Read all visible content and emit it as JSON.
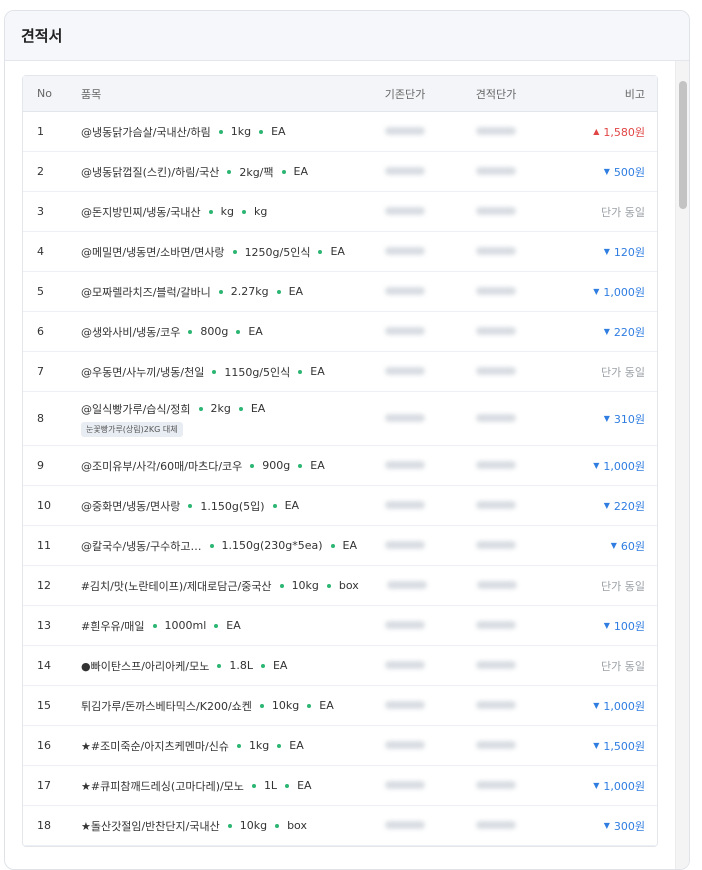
{
  "title": "견적서",
  "columns": {
    "no": "No",
    "item": "품목",
    "base_price": "기존단가",
    "quote_price": "견적단가",
    "note": "비고"
  },
  "rows": [
    {
      "no": "1",
      "parts": [
        "@냉동닭가슴살/국내산/하림",
        "1kg",
        "EA"
      ],
      "tag": "",
      "change": "up",
      "note": "1,580원"
    },
    {
      "no": "2",
      "parts": [
        "@냉동닭껍질(스킨)/하림/국산",
        "2kg/팩",
        "EA"
      ],
      "tag": "",
      "change": "down",
      "note": "500원"
    },
    {
      "no": "3",
      "parts": [
        "@돈지방민찌/냉동/국내산",
        "kg",
        "kg"
      ],
      "tag": "",
      "change": "same",
      "note": "단가 동일"
    },
    {
      "no": "4",
      "parts": [
        "@메밀면/냉동면/소바면/면사랑",
        "1250g/5인식",
        "EA"
      ],
      "tag": "",
      "change": "down",
      "note": "120원"
    },
    {
      "no": "5",
      "parts": [
        "@모짜렐라치즈/블럭/갈바니",
        "2.27kg",
        "EA"
      ],
      "tag": "",
      "change": "down",
      "note": "1,000원"
    },
    {
      "no": "6",
      "parts": [
        "@생와사비/냉동/코우",
        "800g",
        "EA"
      ],
      "tag": "",
      "change": "down",
      "note": "220원"
    },
    {
      "no": "7",
      "parts": [
        "@우동면/사누끼/냉동/천일",
        "1150g/5인식",
        "EA"
      ],
      "tag": "",
      "change": "same",
      "note": "단가 동일"
    },
    {
      "no": "8",
      "parts": [
        "@일식빵가루/습식/정희",
        "2kg",
        "EA"
      ],
      "tag": "눈꽃빵가루(상림)2KG 대체",
      "change": "down",
      "note": "310원"
    },
    {
      "no": "9",
      "parts": [
        "@조미유부/사각/60매/마츠다/코우",
        "900g",
        "EA"
      ],
      "tag": "",
      "change": "down",
      "note": "1,000원"
    },
    {
      "no": "10",
      "parts": [
        "@중화면/냉동/면사랑",
        "1.150g(5입)",
        "EA"
      ],
      "tag": "",
      "change": "down",
      "note": "220원"
    },
    {
      "no": "11",
      "parts": [
        "@칼국수/냉동/구수하고…",
        "1.150g(230g*5ea)",
        "EA"
      ],
      "tag": "",
      "change": "down",
      "note": "60원"
    },
    {
      "no": "12",
      "parts": [
        "#김치/맛(노란테이프)/제대로담근/중국산",
        "10kg",
        "box"
      ],
      "tag": "",
      "change": "same",
      "note": "단가 동일"
    },
    {
      "no": "13",
      "parts": [
        "#흰우유/매일",
        "1000ml",
        "EA"
      ],
      "tag": "",
      "change": "down",
      "note": "100원"
    },
    {
      "no": "14",
      "parts": [
        "●빠이탄스프/아리아케/모노",
        "1.8L",
        "EA"
      ],
      "tag": "",
      "change": "same",
      "note": "단가 동일"
    },
    {
      "no": "15",
      "parts": [
        "튀김가루/돈까스베타믹스/K200/쇼켄",
        "10kg",
        "EA"
      ],
      "tag": "",
      "change": "down",
      "note": "1,000원"
    },
    {
      "no": "16",
      "parts": [
        "★#조미죽순/아지츠케멘마/신슈",
        "1kg",
        "EA"
      ],
      "tag": "",
      "change": "down",
      "note": "1,500원"
    },
    {
      "no": "17",
      "parts": [
        "★#큐피참깨드레싱(고마다레)/모노",
        "1L",
        "EA"
      ],
      "tag": "",
      "change": "down",
      "note": "1,000원"
    },
    {
      "no": "18",
      "parts": [
        "★돌산갓절임/반찬단지/국내산",
        "10kg",
        "box"
      ],
      "tag": "",
      "change": "down",
      "note": "300원"
    }
  ],
  "colors": {
    "up": "#e24545",
    "down": "#2f7de1",
    "same": "#9aa0a6",
    "dot": "#2bb673"
  },
  "icons": {
    "up": "caret-up-icon",
    "down": "caret-down-icon"
  }
}
